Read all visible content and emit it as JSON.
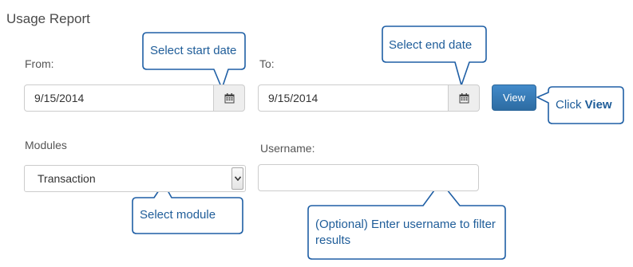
{
  "report": {
    "title": "Usage Report"
  },
  "from": {
    "label": "From:",
    "value": "9/15/2014"
  },
  "to": {
    "label": "To:",
    "value": "9/15/2014"
  },
  "view_button": {
    "label": "View"
  },
  "modules": {
    "label": "Modules",
    "selected": "Transaction"
  },
  "username": {
    "label": "Username:",
    "value": ""
  },
  "callouts": {
    "start_date": "Select start date",
    "end_date": "Select end date",
    "click_prefix": "Click ",
    "click_bold": "View",
    "select_module": "Select module",
    "username_hint": "(Optional) Enter username to filter results"
  },
  "colors": {
    "accent": "#337ab7",
    "callout_text": "#1f5d99",
    "callout_border": "#1f5fa5"
  }
}
